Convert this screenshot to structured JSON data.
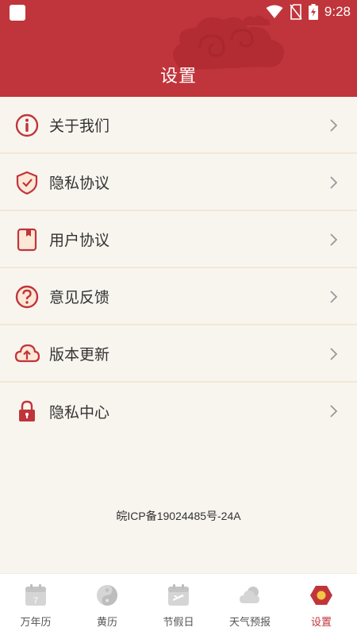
{
  "status_bar": {
    "time": "9:28"
  },
  "header": {
    "title": "设置"
  },
  "menu": {
    "items": [
      {
        "label": "关于我们",
        "icon": "info-icon"
      },
      {
        "label": "隐私协议",
        "icon": "shield-check-icon"
      },
      {
        "label": "用户协议",
        "icon": "document-icon"
      },
      {
        "label": "意见反馈",
        "icon": "question-icon"
      },
      {
        "label": "版本更新",
        "icon": "cloud-upload-icon"
      },
      {
        "label": "隐私中心",
        "icon": "lock-icon"
      }
    ]
  },
  "footer": {
    "icp": "皖ICP备19024485号-24A"
  },
  "tabbar": {
    "tabs": [
      {
        "label": "万年历",
        "icon": "calendar-icon",
        "calendar_day": "7"
      },
      {
        "label": "黄历",
        "icon": "yin-yang-icon"
      },
      {
        "label": "节假日",
        "icon": "holiday-icon"
      },
      {
        "label": "天气预报",
        "icon": "weather-cloud-icon"
      },
      {
        "label": "设置",
        "icon": "settings-hexagon-icon"
      }
    ],
    "active": "设置"
  },
  "colors": {
    "brand_red": "#c0353b",
    "background": "#f8f5ef",
    "divider": "#f3e7d5",
    "inactive_icon": "#cfcfcf"
  }
}
